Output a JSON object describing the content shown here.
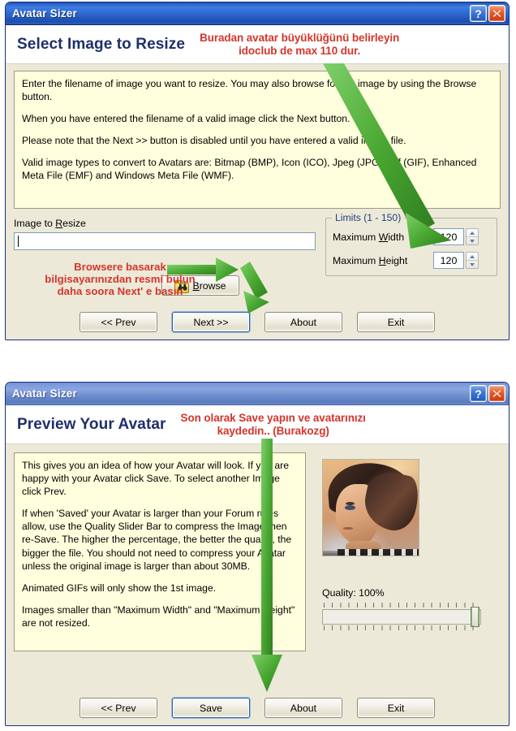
{
  "dialog1": {
    "window_title": "Avatar Sizer",
    "titlebar_buttons": [
      {
        "name": "help",
        "label": "?"
      },
      {
        "name": "close",
        "label": "X"
      }
    ],
    "page_title": "Select Image to Resize",
    "annotation": "Buradan avatar büyüklüğünü belirleyin\nidoclub de max 110 dur.",
    "annotation_color": "#d4352c",
    "info_paragraphs": [
      "Enter the filename of image you want to resize. You may also browse for the image by using the Browse button.",
      "When you have entered the filename of a valid image click the Next button.",
      "Please note that the Next >> button is disabled until you have entered a valid image file.",
      "Valid image types to convert to Avatars are: Bitmap (BMP), Icon (ICO),  Jpeg (JPG),  Gif (GIF), Enhanced Meta File (EMF) and Windows Meta File (WMF)."
    ],
    "image_field": {
      "label_pre": "Image to ",
      "label_accel": "R",
      "label_post": "esize",
      "value": "",
      "placeholder": ""
    },
    "browse_button": {
      "label_accel": "B",
      "label_post": "rowse",
      "icon": "folder-binoculars-icon"
    },
    "annotation_browse": "Browsere basarak\nbilgisayarınızdan resmi bulun\ndaha soora Next' e basın",
    "limits_group": {
      "title": "Limits (1 - 150)",
      "fields": [
        {
          "label_pre": "Maximum ",
          "label_accel": "W",
          "label_post": "idth",
          "value": "120"
        },
        {
          "label_pre": "Maximum ",
          "label_accel": "H",
          "label_post": "eight",
          "value": "120"
        }
      ]
    },
    "footer_buttons": [
      {
        "name": "prev",
        "label": "<< Prev",
        "default": false
      },
      {
        "name": "next",
        "label": "Next >>",
        "default": true
      },
      {
        "name": "about",
        "label": "About",
        "default": false
      },
      {
        "name": "exit",
        "label": "Exit",
        "default": false
      }
    ]
  },
  "dialog2": {
    "window_title": "Avatar Sizer",
    "page_title": "Preview Your Avatar",
    "annotation": "Son olarak Save yapın ve avatarınızı\nkaydedin.. (Burakozg)",
    "info_paragraphs": [
      "This gives you an idea of how your Avatar will look. If you are happy with your Avatar click Save. To select another Image click Prev.",
      "If when 'Saved' your Avatar is larger than your Forum rules allow, use the Quality Slider Bar to compress the Image then re-Save. The higher the percentage, the better the quality, the bigger the file. You should not need to compress your Avatar unless the original image is larger than about 30MB.",
      "Animated GIFs will only show the 1st image.",
      "Images smaller than \"Maximum Width\" and \"Maximum Height\" are not resized."
    ],
    "preview": {
      "name": "avatar-preview-image",
      "description": "game character portrait, dark brown hair, orange sky background"
    },
    "quality": {
      "label": "Quality: 100%",
      "percent": 100
    },
    "footer_buttons": [
      {
        "name": "prev",
        "label": "<< Prev",
        "default": false
      },
      {
        "name": "save",
        "label": "Save",
        "default": true
      },
      {
        "name": "about",
        "label": "About",
        "default": false
      },
      {
        "name": "exit",
        "label": "Exit",
        "default": false
      }
    ]
  },
  "theme": {
    "titlebar_blue": "#2b65cd",
    "dialog_face": "#ece9d8",
    "info_background": "#ffffdd",
    "annotation_red": "#d4352c",
    "arrow_green": "#4aa832",
    "title_text_blue": "#1f2f6b"
  }
}
